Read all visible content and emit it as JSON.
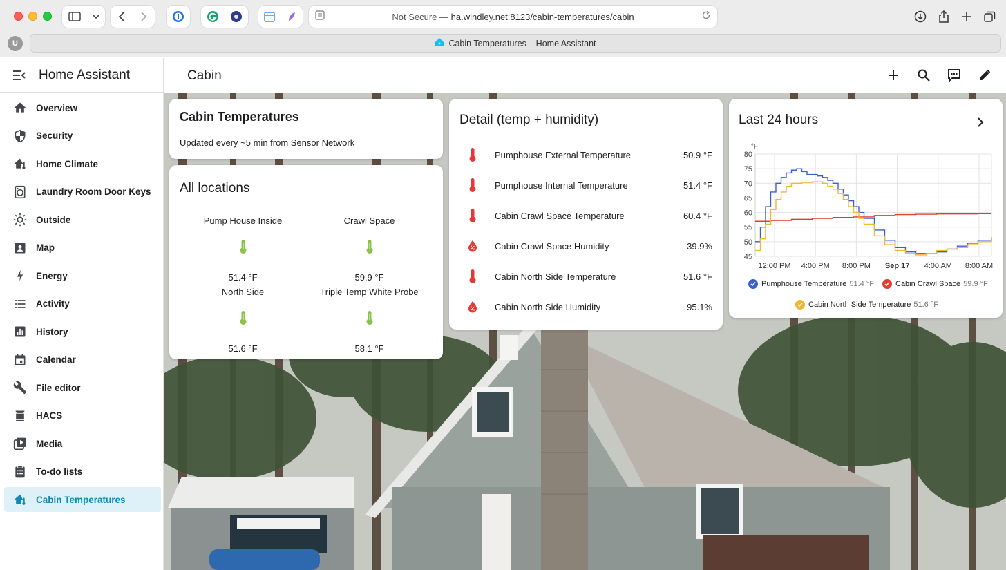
{
  "browser": {
    "url_prefix": "Not Secure — ",
    "url_host": "ha.windley.net:8123/cabin-temperatures/cabin",
    "tab_title": "Cabin Temperatures – Home Assistant",
    "profile_initial": "U"
  },
  "sidebar": {
    "app_title": "Home Assistant",
    "items": [
      {
        "label": "Overview",
        "icon": "home-icon"
      },
      {
        "label": "Security",
        "icon": "shield-icon"
      },
      {
        "label": "Home Climate",
        "icon": "home-thermometer-icon"
      },
      {
        "label": "Laundry Room Door Keys",
        "icon": "washer-icon"
      },
      {
        "label": "Outside",
        "icon": "sun-icon"
      },
      {
        "label": "Map",
        "icon": "map-icon"
      },
      {
        "label": "Energy",
        "icon": "lightning-icon"
      },
      {
        "label": "Activity",
        "icon": "list-icon"
      },
      {
        "label": "History",
        "icon": "chart-icon"
      },
      {
        "label": "Calendar",
        "icon": "calendar-icon"
      },
      {
        "label": "File editor",
        "icon": "wrench-icon"
      },
      {
        "label": "HACS",
        "icon": "hacs-icon"
      },
      {
        "label": "Media",
        "icon": "media-icon"
      },
      {
        "label": "To-do lists",
        "icon": "clipboard-icon"
      },
      {
        "label": "Cabin Temperatures",
        "icon": "home-thermometer-icon",
        "active": true
      }
    ]
  },
  "view": {
    "title": "Cabin"
  },
  "info_card": {
    "title": "Cabin Temperatures",
    "subtitle": "Updated every ~5 min from Sensor Network"
  },
  "locations_card": {
    "title": "All locations",
    "items": [
      {
        "name": "Pump House Inside",
        "value": "51.4 °F"
      },
      {
        "name": "Crawl Space",
        "value": "59.9 °F"
      },
      {
        "name": "North Side",
        "value": "51.6 °F"
      },
      {
        "name": "Triple Temp White Probe",
        "value": "58.1 °F"
      }
    ]
  },
  "detail_card": {
    "title": "Detail (temp + humidity)",
    "entities": [
      {
        "name": "Pumphouse External Temperature",
        "value": "50.9 °F",
        "icon": "thermometer-icon"
      },
      {
        "name": "Pumphouse Internal Temperature",
        "value": "51.4 °F",
        "icon": "thermometer-icon"
      },
      {
        "name": "Cabin Crawl Space Temperature",
        "value": "60.4 °F",
        "icon": "thermometer-icon"
      },
      {
        "name": "Cabin Crawl Space Humidity",
        "value": "39.9%",
        "icon": "water-percent-icon"
      },
      {
        "name": "Cabin North Side Temperature",
        "value": "51.6 °F",
        "icon": "thermometer-icon"
      },
      {
        "name": "Cabin North Side Humidity",
        "value": "95.1%",
        "icon": "water-percent-icon"
      }
    ]
  },
  "history_card": {
    "title": "Last 24 hours"
  },
  "chart_data": {
    "type": "line",
    "title": "",
    "ylabel": "°F",
    "ylim": [
      45,
      80
    ],
    "yticks": [
      45,
      50,
      55,
      60,
      65,
      70,
      75,
      80
    ],
    "xticks": [
      "12:00 PM",
      "4:00 PM",
      "8:00 PM",
      "Sep 17",
      "4:00 AM",
      "8:00 AM"
    ],
    "xlim": [
      10.5,
      33.3
    ],
    "grid": true,
    "legend_position": "bottom",
    "series": [
      {
        "name": "Pumphouse Temperature",
        "current": "51.4 °F",
        "color": "#3b5fcd",
        "x": [
          10.5,
          11.0,
          11.5,
          12.0,
          12.5,
          13.0,
          13.5,
          14.0,
          14.5,
          15.0,
          15.5,
          16.0,
          16.5,
          17.0,
          17.5,
          18.0,
          18.5,
          19.0,
          19.5,
          20.0,
          20.5,
          21.0,
          22.0,
          23.0,
          24.0,
          25.0,
          26.0,
          27.0,
          28.0,
          29.0,
          30.0,
          31.0,
          32.0,
          33.3
        ],
        "y": [
          50,
          55,
          62,
          67,
          70,
          72,
          73.5,
          74.5,
          75,
          74,
          73,
          73,
          72.5,
          72,
          71,
          70,
          68,
          66,
          64,
          62,
          60,
          58,
          54,
          50.5,
          48,
          46.5,
          46,
          46,
          46.5,
          47.5,
          48.5,
          49.5,
          50.5,
          51.4
        ]
      },
      {
        "name": "Cabin Crawl Space",
        "current": "59.9 °F",
        "color": "#e03c31",
        "x": [
          10.5,
          12.0,
          14.0,
          16.0,
          18.0,
          20.0,
          22.0,
          24.0,
          26.0,
          28.0,
          30.0,
          32.0,
          33.3
        ],
        "y": [
          57,
          57.3,
          57.7,
          58,
          58.3,
          58.5,
          59,
          59.3,
          59.4,
          59.5,
          59.5,
          59.6,
          59.6
        ]
      },
      {
        "name": "Cabin North Side Temperature",
        "current": "51.6 °F",
        "color": "#f2b534",
        "x": [
          10.5,
          11.0,
          11.5,
          12.0,
          12.5,
          13.0,
          13.5,
          14.0,
          15.0,
          16.0,
          17.0,
          17.5,
          18.0,
          18.5,
          19.0,
          19.5,
          20.0,
          20.5,
          21.0,
          22.0,
          23.0,
          24.0,
          25.0,
          26.0,
          27.0,
          28.0,
          29.0,
          30.0,
          31.0,
          32.0,
          33.3
        ],
        "y": [
          47,
          51,
          56,
          61,
          64.5,
          67,
          69,
          70,
          70.3,
          70.5,
          70,
          69,
          68,
          66.5,
          64.5,
          62,
          60,
          58,
          56,
          52,
          49,
          47,
          46,
          45.5,
          46,
          47,
          47.5,
          48,
          49,
          50,
          51.6
        ]
      }
    ]
  }
}
